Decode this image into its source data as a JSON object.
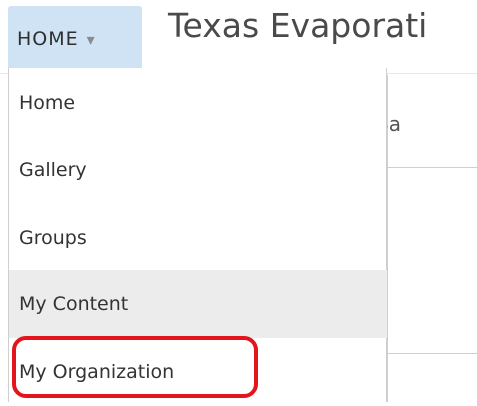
{
  "header": {
    "home_menu_label": "HOME",
    "home_menu_caret": "▾",
    "page_title": "Texas Evaporati"
  },
  "background": {
    "partial_text": "Ba"
  },
  "menu": {
    "items": [
      {
        "label": "Home",
        "highlighted": false
      },
      {
        "label": "Gallery",
        "highlighted": false
      },
      {
        "label": "Groups",
        "highlighted": false
      },
      {
        "label": "My Content",
        "highlighted": true
      },
      {
        "label": "My Organization",
        "highlighted": false
      }
    ]
  },
  "colors": {
    "home_button_bg": "#cfe3f5",
    "hover_bg": "#ececec",
    "annotation_red": "#e3141b"
  }
}
